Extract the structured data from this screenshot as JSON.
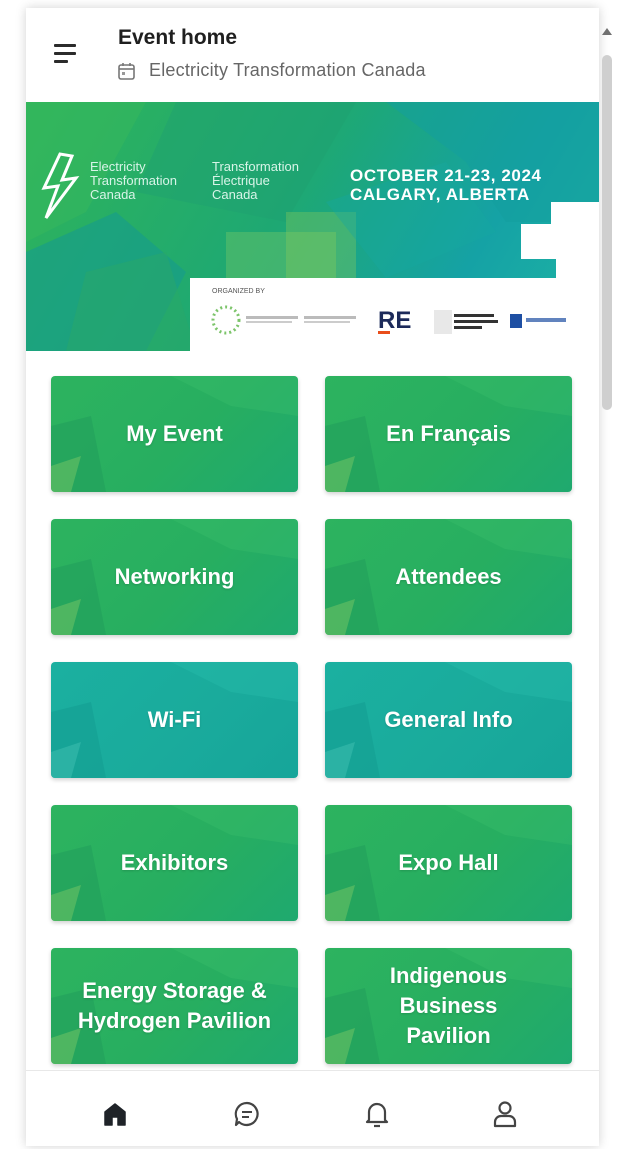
{
  "header": {
    "title": "Event home",
    "subtitle": "Electricity Transformation Canada",
    "menu_icon": "hamburger-menu-icon",
    "subtitle_icon": "calendar-icon"
  },
  "banner": {
    "name_en": [
      "Electricity",
      "Transformation",
      "Canada"
    ],
    "name_fr": [
      "Transformation",
      "Électrique",
      "Canada"
    ],
    "date_line": "OCTOBER 21-23, 2024",
    "location_line": "CALGARY, ALBERTA",
    "organized_by": "ORGANIZED BY",
    "logo_re": "RE",
    "logo_partner": "ITALIAN EXHIBITION GROUP"
  },
  "tiles": [
    {
      "label": "My Event",
      "style": "green"
    },
    {
      "label": "En Français",
      "style": "green"
    },
    {
      "label": "Networking",
      "style": "green"
    },
    {
      "label": "Attendees",
      "style": "green"
    },
    {
      "label": "Wi-Fi",
      "style": "teal"
    },
    {
      "label": "General Info",
      "style": "teal"
    },
    {
      "label": "Exhibitors",
      "style": "green"
    },
    {
      "label": "Expo Hall",
      "style": "green"
    },
    {
      "label": "Energy Storage & Hydrogen Pavilion",
      "style": "green"
    },
    {
      "label": "Indigenous Business Pavilion",
      "style": "green"
    }
  ],
  "bottom_nav": [
    {
      "name": "home",
      "icon": "home-icon",
      "active": true
    },
    {
      "name": "messages",
      "icon": "chat-icon",
      "active": false
    },
    {
      "name": "notifications",
      "icon": "bell-icon",
      "active": false
    },
    {
      "name": "profile",
      "icon": "user-icon",
      "active": false
    }
  ],
  "colors": {
    "tile_green": "#27ae60",
    "tile_teal": "#1aab9c",
    "header_text": "#1f1f1f",
    "nav_active": "#1f2328",
    "nav_inactive": "#555555"
  }
}
